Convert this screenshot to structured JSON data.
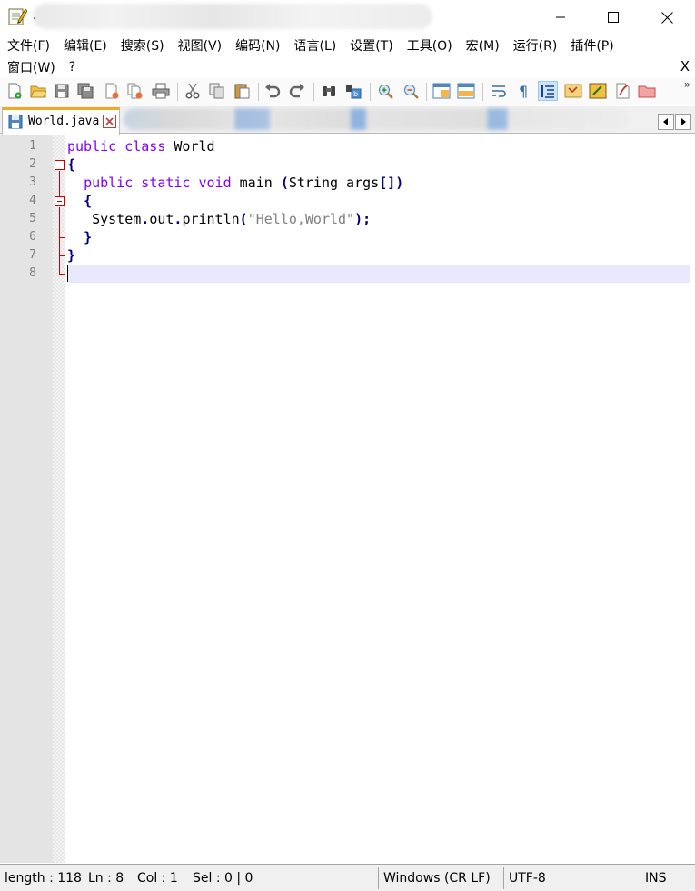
{
  "window": {
    "title": "."
  },
  "menu": {
    "row1": [
      "文件(F)",
      "编辑(E)",
      "搜索(S)",
      "视图(V)",
      "编码(N)",
      "语言(L)",
      "设置(T)",
      "工具(O)",
      "宏(M)",
      "运行(R)",
      "插件(P)"
    ],
    "row2": [
      "窗口(W)",
      "?"
    ],
    "close_label": "X"
  },
  "toolbar": {
    "icons": [
      "new-file-icon",
      "open-file-icon",
      "save-icon",
      "save-all-icon",
      "close-icon",
      "close-all-icon",
      "print-icon",
      "cut-icon",
      "copy-icon",
      "paste-icon",
      "undo-icon",
      "redo-icon",
      "find-icon",
      "replace-icon",
      "zoom-in-icon",
      "zoom-out-icon",
      "sync-vertical-icon",
      "sync-horizontal-icon",
      "word-wrap-icon",
      "show-all-chars-icon",
      "indent-guide-icon",
      "document-map-icon",
      "function-list-icon",
      "folder-workspace-icon",
      "monitoring-icon"
    ],
    "more_label": "»"
  },
  "tabs": {
    "active": {
      "label": "World.java"
    }
  },
  "editor": {
    "line_numbers": [
      "1",
      "2",
      "3",
      "4",
      "5",
      "6",
      "7",
      "8"
    ],
    "current_line": 8
  },
  "status": {
    "length": "length : 118",
    "ln": "Ln : 8",
    "col": "Col : 1",
    "sel": "Sel : 0 | 0",
    "eol": "Windows (CR LF)",
    "encoding": "UTF-8",
    "mode": "INS"
  },
  "colors": {
    "keyword": "#8000ff",
    "operator": "#000080",
    "string": "#808080",
    "current_line_bg": "#e8e8ff",
    "fold_marker": "#d10000",
    "tab_accent": "#f5a623"
  }
}
